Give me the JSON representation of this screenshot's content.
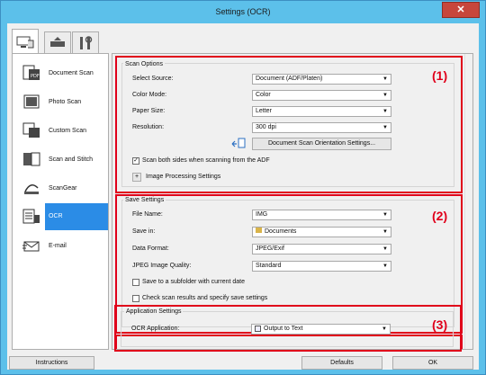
{
  "window": {
    "title": "Settings (OCR)",
    "close_symbol": "✕"
  },
  "tabs": [
    {
      "name": "scan-from-computer",
      "icon": "computer-scan-icon"
    },
    {
      "name": "scan-from-panel",
      "icon": "scanner-icon"
    },
    {
      "name": "general-settings",
      "icon": "tools-icon"
    }
  ],
  "sidebar": {
    "items": [
      {
        "label": "Document Scan",
        "icon": "document-scan-icon"
      },
      {
        "label": "Photo Scan",
        "icon": "photo-scan-icon"
      },
      {
        "label": "Custom Scan",
        "icon": "custom-scan-icon"
      },
      {
        "label": "Scan and Stitch",
        "icon": "stitch-icon"
      },
      {
        "label": "ScanGear",
        "icon": "scangear-icon"
      },
      {
        "label": "OCR",
        "icon": "ocr-icon",
        "active": true
      },
      {
        "label": "E-mail",
        "icon": "email-icon"
      }
    ]
  },
  "scan_options": {
    "title": "Scan Options",
    "number": "(1)",
    "select_source_label": "Select Source:",
    "select_source_value": "Document (ADF/Platen)",
    "color_mode_label": "Color Mode:",
    "color_mode_value": "Color",
    "paper_size_label": "Paper Size:",
    "paper_size_value": "Letter",
    "resolution_label": "Resolution:",
    "resolution_value": "300 dpi",
    "orientation_button": "Document Scan Orientation Settings...",
    "scan_both_sides": "Scan both sides when scanning from the ADF",
    "scan_both_sides_checked": true,
    "image_processing": "Image Processing Settings",
    "expand_symbol": "+"
  },
  "save_settings": {
    "title": "Save Settings",
    "number": "(2)",
    "file_name_label": "File Name:",
    "file_name_value": "IMG",
    "save_in_label": "Save in:",
    "save_in_value": "Documents",
    "data_format_label": "Data Format:",
    "data_format_value": "JPEG/Exif",
    "jpeg_quality_label": "JPEG Image Quality:",
    "jpeg_quality_value": "Standard",
    "subfolder_label": "Save to a subfolder with current date",
    "check_results_label": "Check scan results and specify save settings"
  },
  "application_settings": {
    "title": "Application Settings",
    "number": "(3)",
    "ocr_app_label": "OCR Application:",
    "ocr_app_value": "Output to Text"
  },
  "footer": {
    "instructions": "Instructions",
    "defaults": "Defaults",
    "ok": "OK"
  },
  "colors": {
    "highlight": "#e0001a",
    "selected": "#2b8ce6"
  }
}
